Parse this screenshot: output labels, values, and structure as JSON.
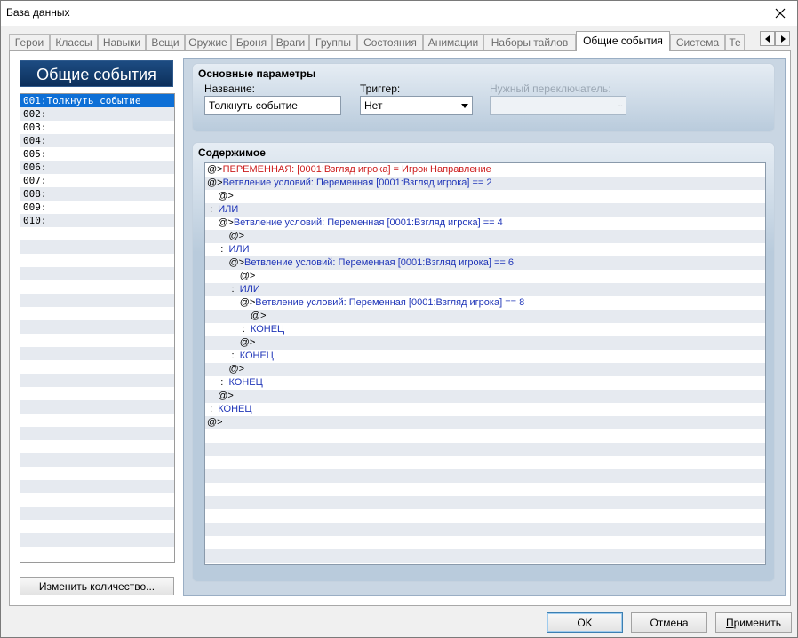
{
  "window": {
    "title": "База данных"
  },
  "tabs": [
    {
      "label": "Герои"
    },
    {
      "label": "Классы"
    },
    {
      "label": "Навыки"
    },
    {
      "label": "Вещи"
    },
    {
      "label": "Оружие"
    },
    {
      "label": "Броня"
    },
    {
      "label": "Враги"
    },
    {
      "label": "Группы"
    },
    {
      "label": "Состояния"
    },
    {
      "label": "Анимации"
    },
    {
      "label": "Наборы тайлов"
    },
    {
      "label": "Общие события"
    },
    {
      "label": "Система"
    },
    {
      "label": "Те"
    }
  ],
  "active_tab": "Общие события",
  "left_panel": {
    "header": "Общие события",
    "items": [
      {
        "label": "001:Толкнуть событие",
        "selected": true
      },
      {
        "label": "002:"
      },
      {
        "label": "003:"
      },
      {
        "label": "004:"
      },
      {
        "label": "005:"
      },
      {
        "label": "006:"
      },
      {
        "label": "007:"
      },
      {
        "label": "008:"
      },
      {
        "label": "009:"
      },
      {
        "label": "010:"
      },
      {
        "label": ""
      },
      {
        "label": ""
      },
      {
        "label": ""
      },
      {
        "label": ""
      },
      {
        "label": ""
      },
      {
        "label": ""
      },
      {
        "label": ""
      },
      {
        "label": ""
      },
      {
        "label": ""
      },
      {
        "label": ""
      },
      {
        "label": ""
      },
      {
        "label": ""
      },
      {
        "label": ""
      },
      {
        "label": ""
      },
      {
        "label": ""
      },
      {
        "label": ""
      },
      {
        "label": ""
      },
      {
        "label": ""
      },
      {
        "label": ""
      },
      {
        "label": ""
      },
      {
        "label": ""
      },
      {
        "label": ""
      },
      {
        "label": ""
      },
      {
        "label": ""
      },
      {
        "label": ""
      }
    ],
    "change_count_label": "Изменить количество..."
  },
  "params": {
    "title": "Основные параметры",
    "name_label": "Название:",
    "name_value": "Толкнуть событие",
    "trigger_label": "Триггер:",
    "trigger_value": "Нет",
    "switch_label": "Нужный переключатель:",
    "switch_value": "",
    "switch_button": "..."
  },
  "contents": {
    "title": "Содержимое",
    "lines": [
      {
        "indent": "",
        "prefix": "@>",
        "text": "ПЕРЕМЕННАЯ: [0001:Взгляд игрока] = Игрок Направление",
        "color": "#cc1c1c"
      },
      {
        "indent": "",
        "prefix": "@>",
        "text": "Ветвление условий: Переменная [0001:Взгляд игрока] == 2",
        "color": "#1f35b8"
      },
      {
        "indent": "    ",
        "prefix": "@>",
        "text": "",
        "color": "#000000"
      },
      {
        "indent": " ",
        "prefix": ":  ",
        "text": "ИЛИ",
        "color": "#1f35b8"
      },
      {
        "indent": "    ",
        "prefix": "@>",
        "text": "Ветвление условий: Переменная [0001:Взгляд игрока] == 4",
        "color": "#1f35b8"
      },
      {
        "indent": "        ",
        "prefix": "@>",
        "text": "",
        "color": "#000000"
      },
      {
        "indent": "     ",
        "prefix": ":  ",
        "text": "ИЛИ",
        "color": "#1f35b8"
      },
      {
        "indent": "        ",
        "prefix": "@>",
        "text": "Ветвление условий: Переменная [0001:Взгляд игрока] == 6",
        "color": "#1f35b8"
      },
      {
        "indent": "            ",
        "prefix": "@>",
        "text": "",
        "color": "#000000"
      },
      {
        "indent": "         ",
        "prefix": ":  ",
        "text": "ИЛИ",
        "color": "#1f35b8"
      },
      {
        "indent": "            ",
        "prefix": "@>",
        "text": "Ветвление условий: Переменная [0001:Взгляд игрока] == 8",
        "color": "#1f35b8"
      },
      {
        "indent": "                ",
        "prefix": "@>",
        "text": "",
        "color": "#000000"
      },
      {
        "indent": "             ",
        "prefix": ":  ",
        "text": "КОНЕЦ",
        "color": "#1f35b8"
      },
      {
        "indent": "            ",
        "prefix": "@>",
        "text": "",
        "color": "#000000"
      },
      {
        "indent": "         ",
        "prefix": ":  ",
        "text": "КОНЕЦ",
        "color": "#1f35b8"
      },
      {
        "indent": "        ",
        "prefix": "@>",
        "text": "",
        "color": "#000000"
      },
      {
        "indent": "     ",
        "prefix": ":  ",
        "text": "КОНЕЦ",
        "color": "#1f35b8"
      },
      {
        "indent": "    ",
        "prefix": "@>",
        "text": "",
        "color": "#000000"
      },
      {
        "indent": " ",
        "prefix": ":  ",
        "text": "КОНЕЦ",
        "color": "#1f35b8"
      },
      {
        "indent": "",
        "prefix": "@>",
        "text": "",
        "color": "#000000"
      },
      {
        "indent": "",
        "prefix": "",
        "text": "",
        "color": "#000000"
      },
      {
        "indent": "",
        "prefix": "",
        "text": "",
        "color": "#000000"
      },
      {
        "indent": "",
        "prefix": "",
        "text": "",
        "color": "#000000"
      },
      {
        "indent": "",
        "prefix": "",
        "text": "",
        "color": "#000000"
      },
      {
        "indent": "",
        "prefix": "",
        "text": "",
        "color": "#000000"
      },
      {
        "indent": "",
        "prefix": "",
        "text": "",
        "color": "#000000"
      },
      {
        "indent": "",
        "prefix": "",
        "text": "",
        "color": "#000000"
      },
      {
        "indent": "",
        "prefix": "",
        "text": "",
        "color": "#000000"
      },
      {
        "indent": "",
        "prefix": "",
        "text": "",
        "color": "#000000"
      },
      {
        "indent": "",
        "prefix": "",
        "text": "",
        "color": "#000000"
      }
    ]
  },
  "buttons": {
    "ok": "OK",
    "cancel": "Отмена",
    "apply_underlined": "П",
    "apply_rest": "рименить"
  },
  "colors": {
    "accent": "#0d6fd6",
    "code_blue": "#1f35b8",
    "code_red": "#cc1c1c",
    "group_bg": "#c9d6e3"
  },
  "icons": {
    "close": "close-icon",
    "scroll_left": "arrow-left-icon",
    "scroll_right": "arrow-right-icon",
    "dropdown": "chevron-down-icon"
  }
}
